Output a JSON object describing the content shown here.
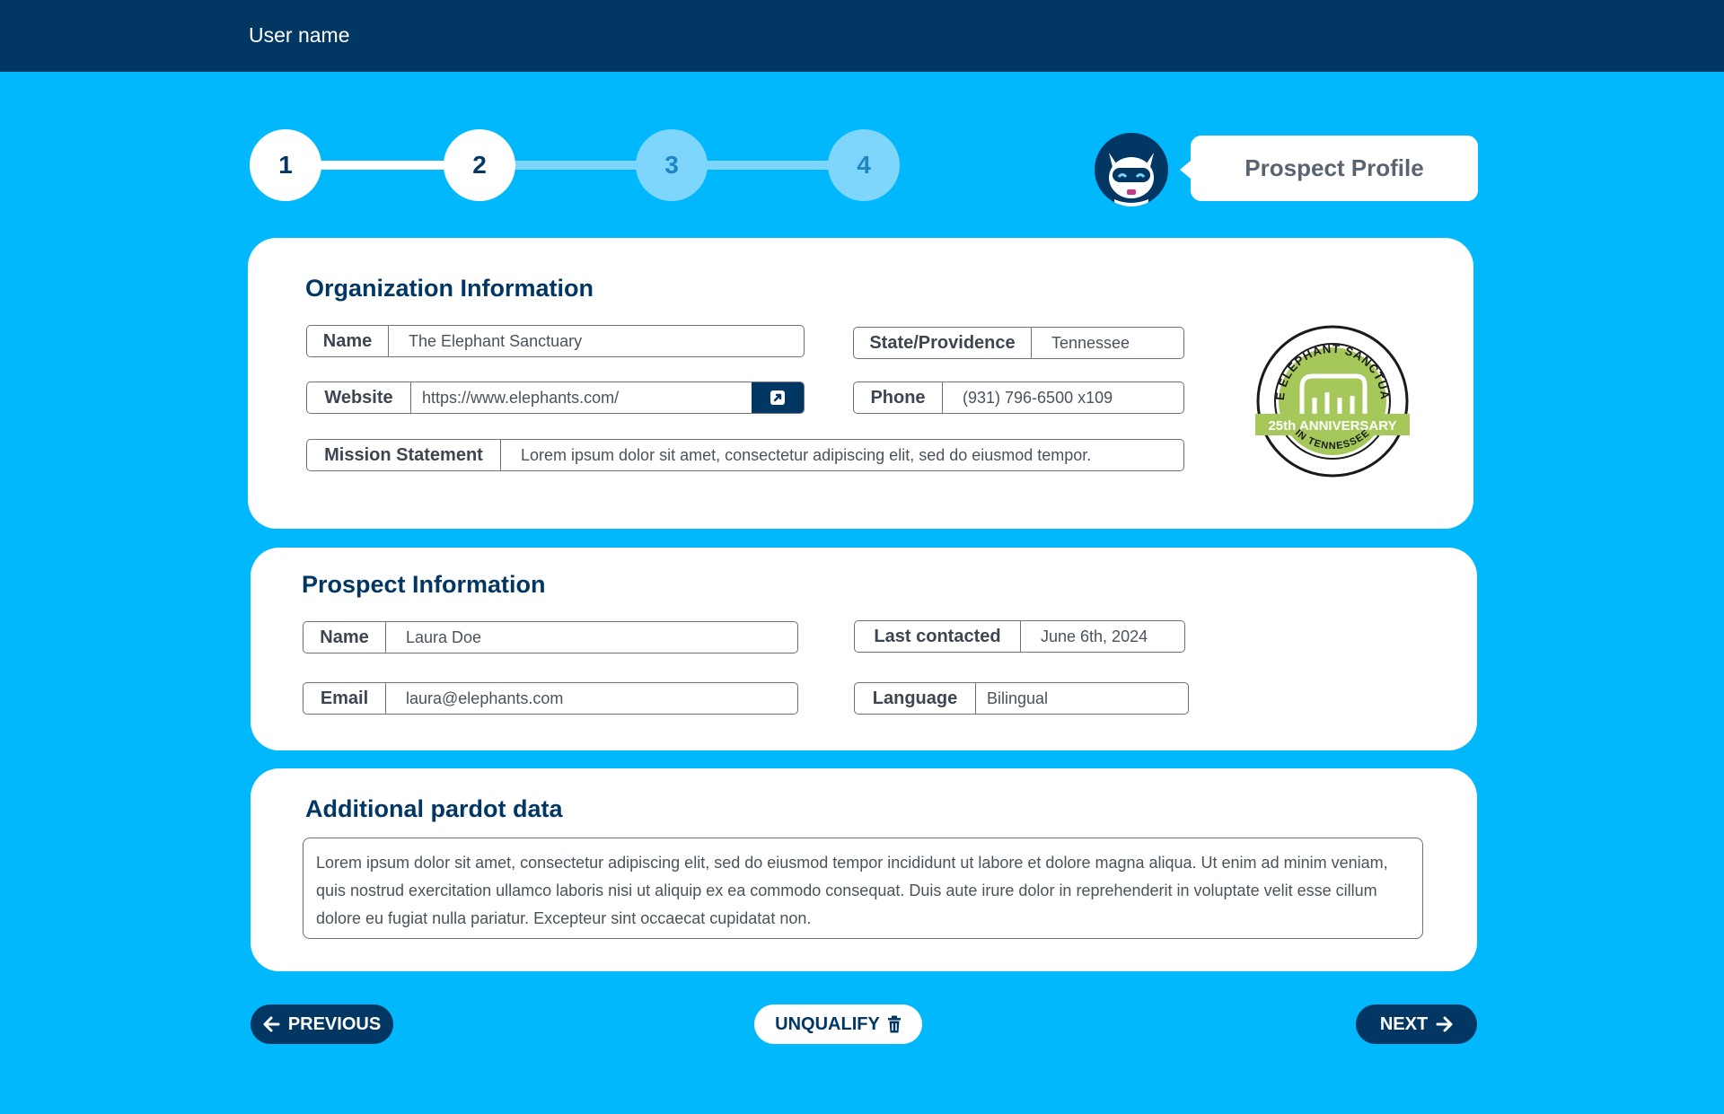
{
  "header": {
    "user_name": "User name"
  },
  "stepper": {
    "steps": [
      "1",
      "2",
      "3",
      "4"
    ],
    "current_step": 2
  },
  "profile": {
    "title": "Prospect Profile"
  },
  "organization": {
    "heading": "Organization Information",
    "name_label": "Name",
    "name_value": "The Elephant Sanctuary",
    "state_label": "State/Providence",
    "state_value": "Tennessee",
    "website_label": "Website",
    "website_value": "https://www.elephants.com/",
    "phone_label": "Phone",
    "phone_value": "(931) 796-6500 x109",
    "mission_label": "Mission Statement",
    "mission_value": "Lorem ipsum dolor sit amet, consectetur adipiscing elit, sed do eiusmod tempor.",
    "logo": {
      "arc_text": "THE ELEPHANT SANCTUARY",
      "banner_text": "25th ANNIVERSARY",
      "bottom_text": "IN TENNESSEE"
    }
  },
  "prospect": {
    "heading": "Prospect Information",
    "name_label": "Name",
    "name_value": "Laura Doe",
    "last_contacted_label": "Last contacted",
    "last_contacted_value": "June 6th, 2024",
    "email_label": "Email",
    "email_value": "laura@elephants.com",
    "language_label": "Language",
    "language_value": "Bilingual"
  },
  "pardot": {
    "heading": "Additional pardot data",
    "text": "Lorem ipsum dolor sit amet, consectetur adipiscing elit, sed do eiusmod tempor incididunt ut labore et dolore magna aliqua. Ut enim ad minim veniam, quis nostrud exercitation ullamco laboris nisi ut aliquip ex ea commodo consequat. Duis aute irure dolor in reprehenderit in voluptate velit esse cillum dolore eu fugiat nulla pariatur. Excepteur sint occaecat cupidatat non."
  },
  "actions": {
    "previous_label": "PREVIOUS",
    "unqualify_label": "UNQUALIFY",
    "next_label": "NEXT"
  },
  "colors": {
    "background": "#00b8fb",
    "navy": "#023764",
    "step_pending": "#7ed6fc",
    "logo_green": "#a6c85a"
  },
  "icons": {
    "external_link": "external-link-icon",
    "trash": "trash-icon",
    "arrow_left": "arrow-left-icon",
    "arrow_right": "arrow-right-icon",
    "mascot": "cat-mascot-icon"
  }
}
